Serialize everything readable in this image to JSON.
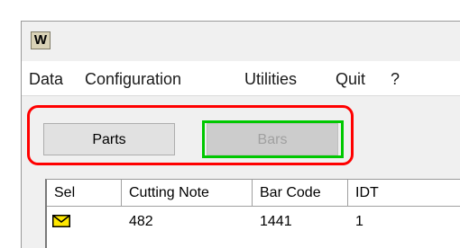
{
  "window": {
    "icon_letter": "W"
  },
  "menu": [
    "Data",
    "Configuration",
    "Utilities",
    "Quit",
    "?"
  ],
  "buttons": {
    "parts": "Parts",
    "bars": "Bars"
  },
  "grid": {
    "columns": [
      "Sel",
      "Cutting Note",
      "Bar Code",
      "IDT"
    ],
    "rows": [
      {
        "sel_icon": "envelope-icon",
        "cutting_note": "482",
        "bar_code": "1441",
        "idt": "1"
      }
    ]
  },
  "colors": {
    "highlight_red": "#ff0000",
    "highlight_green": "#00c800",
    "envelope": "#ffe800"
  }
}
